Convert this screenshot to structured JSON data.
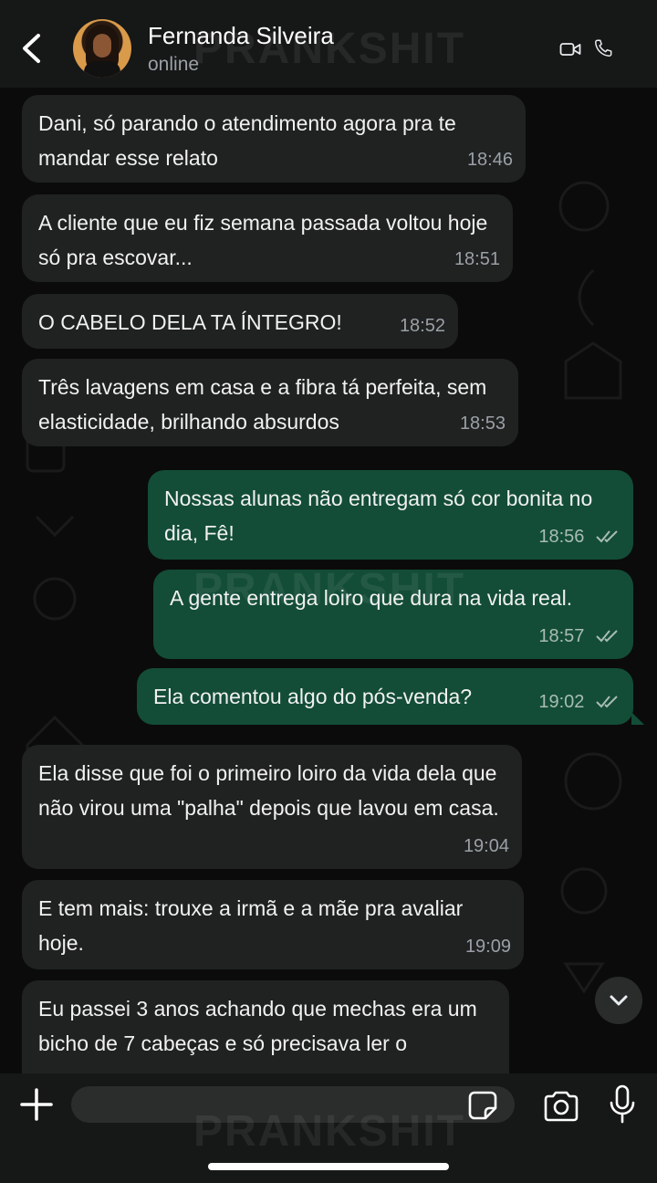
{
  "header": {
    "contact_name": "Fernanda Silveira",
    "status": "online"
  },
  "watermark": "PRANKSHIT",
  "messages": [
    {
      "direction": "in",
      "text": "Dani, só parando o atendimento agora pra te mandar esse relato",
      "time": "18:46"
    },
    {
      "direction": "in",
      "text": "A cliente que eu fiz semana passada voltou hoje só pra escovar...",
      "time": "18:51"
    },
    {
      "direction": "in",
      "text": "O CABELO DELA TA ÍNTEGRO!",
      "time": "18:52"
    },
    {
      "direction": "in",
      "text": "Três lavagens em casa e a fibra tá perfeita, sem elasticidade, brilhando absurdos",
      "time": "18:53"
    },
    {
      "direction": "out",
      "text": "Nossas alunas não entregam só cor bonita no dia, Fê!",
      "time": "18:56",
      "status": "read"
    },
    {
      "direction": "out",
      "text": "A gente entrega loiro que dura na vida real.",
      "time": "18:57",
      "status": "read"
    },
    {
      "direction": "out",
      "text": "Ela comentou algo do pós-venda?",
      "time": "19:02",
      "status": "read"
    },
    {
      "direction": "in",
      "text": "Ela disse que foi o primeiro loiro da vida dela que não virou uma \"palha\" depois que lavou em casa.",
      "time": "19:04"
    },
    {
      "direction": "in",
      "text": "E tem mais: trouxe a irmã e a mãe pra avaliar hoje.",
      "time": "19:09"
    },
    {
      "direction": "in",
      "text": "Eu passei 3 anos achando que mechas era um bicho de 7 cabeças e só precisava ler o",
      "time": ""
    }
  ],
  "composer": {
    "input_value": "",
    "input_placeholder": ""
  },
  "colors": {
    "incoming_bubble": "#202222",
    "outgoing_bubble": "#134d37",
    "background": "#0b0b0b",
    "read_ticks": "#a8bdb2"
  },
  "icons": [
    "back-arrow-icon",
    "video-call-icon",
    "phone-icon",
    "double-check-icon",
    "chevron-down-icon",
    "plus-icon",
    "sticker-icon",
    "camera-icon",
    "microphone-icon"
  ]
}
